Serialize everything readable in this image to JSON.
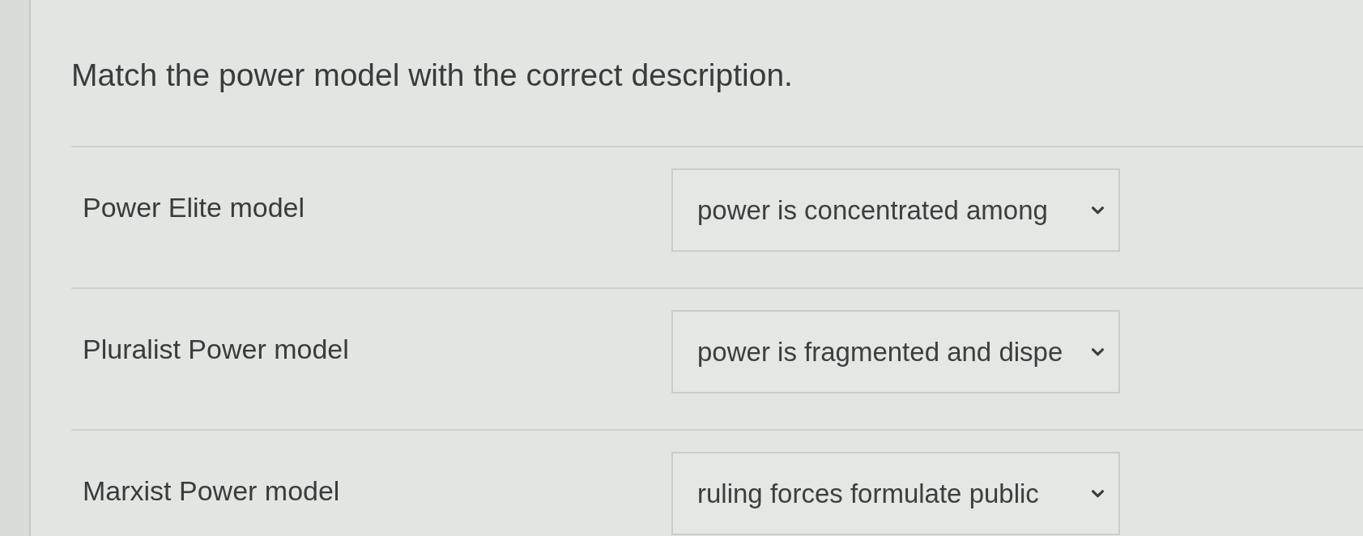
{
  "prompt": "Match the power model with the correct description.",
  "rows": [
    {
      "term": "Power Elite model",
      "answer": {
        "value": "power is concentrated among"
      }
    },
    {
      "term": "Pluralist Power model",
      "answer": {
        "value": "power is fragmented and dispe"
      }
    },
    {
      "term": "Marxist Power model",
      "answer": {
        "value": "ruling forces formulate public"
      }
    }
  ]
}
